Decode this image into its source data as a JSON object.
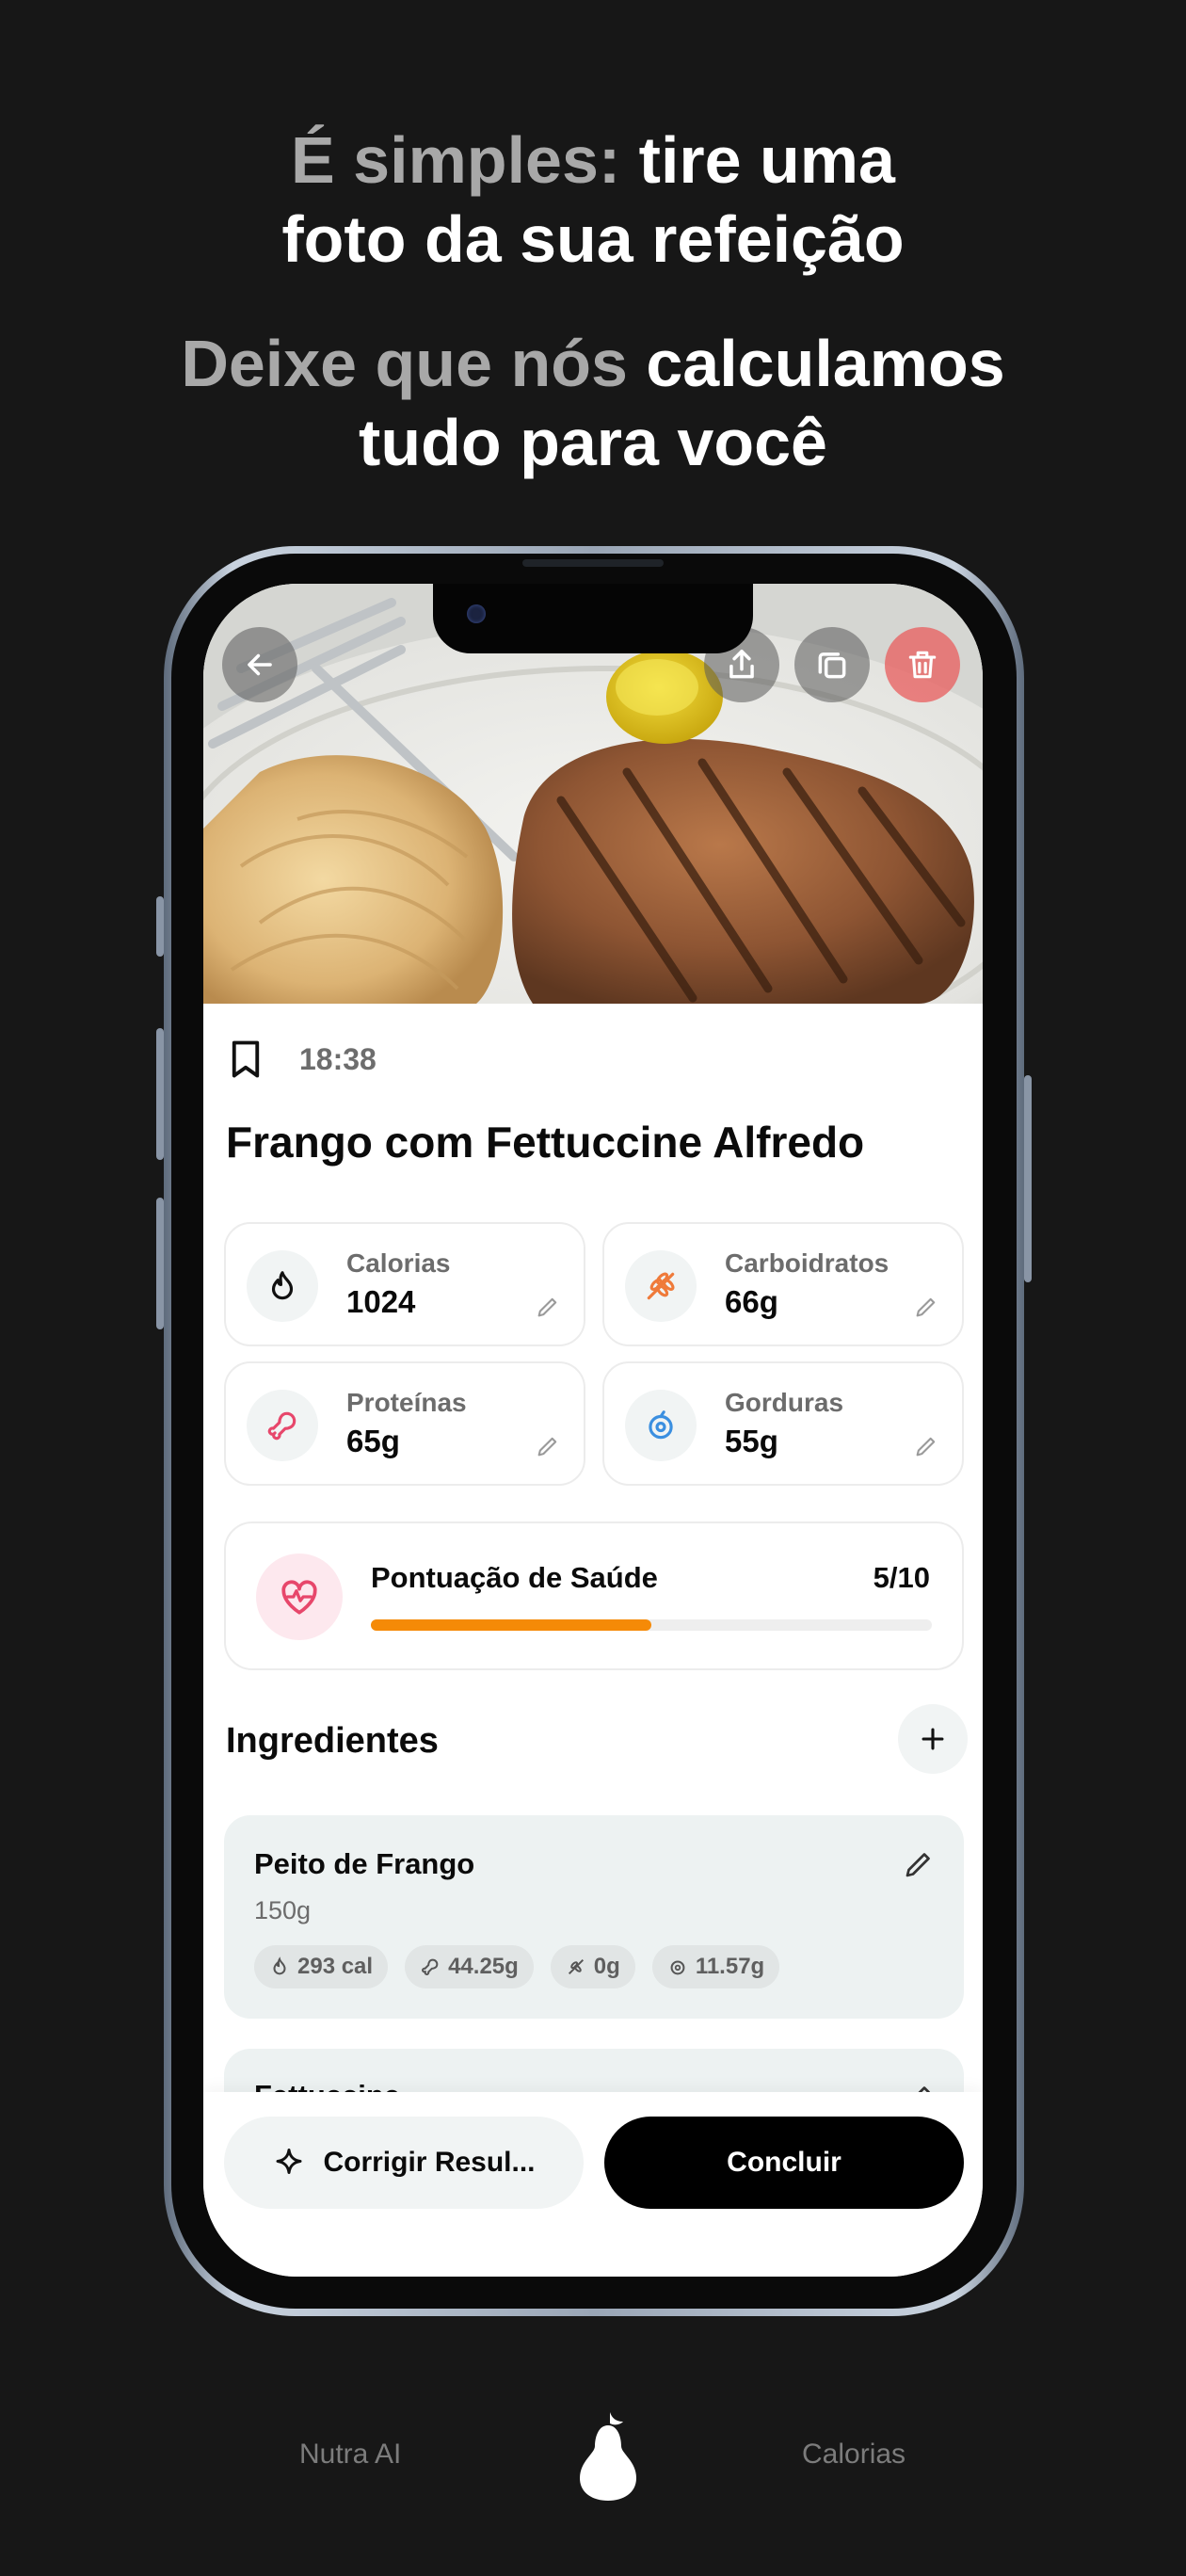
{
  "headline": {
    "line1_muted": "É simples:",
    "line1_bright": " tire uma",
    "line2": "foto da sua refeição",
    "line3_muted": "Deixe que nós",
    "line3_bright": " calculamos",
    "line4": "tudo para você"
  },
  "toolbar": {
    "back_icon": "arrow-left-icon",
    "share_icon": "share-icon",
    "duplicate_icon": "copy-icon",
    "delete_icon": "trash-icon"
  },
  "meal": {
    "time": "18:38",
    "title": "Frango com Fettuccine Alfredo"
  },
  "macros": [
    {
      "label": "Calorias",
      "value": "1024",
      "icon": "flame-icon",
      "color": "#111111"
    },
    {
      "label": "Carboidratos",
      "value": "66g",
      "icon": "wheat-icon",
      "color": "#ef7a3a"
    },
    {
      "label": "Proteínas",
      "value": "65g",
      "icon": "drumstick-icon",
      "color": "#e7476b"
    },
    {
      "label": "Gorduras",
      "value": "55g",
      "icon": "droplet-icon",
      "color": "#3b8fe0"
    }
  ],
  "health": {
    "label": "Pontuação de Saúde",
    "score_text": "5/10",
    "score": 5,
    "max": 10,
    "bar_color": "#f58a07"
  },
  "ingredients": {
    "title": "Ingredientes",
    "items": [
      {
        "name": "Peito de Frango",
        "weight": "150g",
        "calories": "293 cal",
        "protein": "44.25g",
        "carbs": "0g",
        "fat": "11.57g"
      },
      {
        "name": "Fettuccine"
      }
    ]
  },
  "actions": {
    "correct_label": "Corrigir Resul...",
    "done_label": "Concluir"
  },
  "footer": {
    "left": "Nutra AI",
    "right": "Calorias"
  }
}
